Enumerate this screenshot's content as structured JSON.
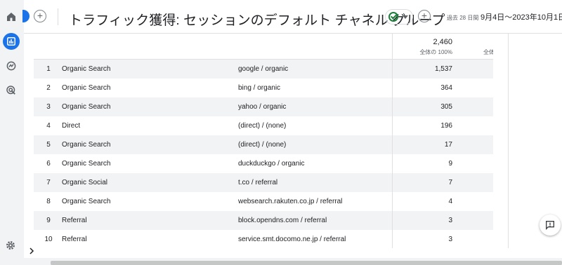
{
  "header": {
    "title": "トラフィック獲得: セッションのデフォルト チャネル グループ",
    "date_label": "過去 28 日間",
    "date_range": "9月4日～2023年10月1日"
  },
  "totals": {
    "value": "2,460",
    "sub": "全体の 100%",
    "sub_next": "全体"
  },
  "rows": [
    {
      "index": "1",
      "group": "Organic Search",
      "source": "google / organic",
      "value": "1,537"
    },
    {
      "index": "2",
      "group": "Organic Search",
      "source": "bing / organic",
      "value": "364"
    },
    {
      "index": "3",
      "group": "Organic Search",
      "source": "yahoo / organic",
      "value": "305"
    },
    {
      "index": "4",
      "group": "Direct",
      "source": "(direct) / (none)",
      "value": "196"
    },
    {
      "index": "5",
      "group": "Organic Search",
      "source": "(direct) / (none)",
      "value": "17"
    },
    {
      "index": "6",
      "group": "Organic Search",
      "source": "duckduckgo / organic",
      "value": "9"
    },
    {
      "index": "7",
      "group": "Organic Social",
      "source": "t.co / referral",
      "value": "7"
    },
    {
      "index": "8",
      "group": "Organic Search",
      "source": "websearch.rakuten.co.jp / referral",
      "value": "4"
    },
    {
      "index": "9",
      "group": "Referral",
      "source": "block.opendns.com / referral",
      "value": "3"
    },
    {
      "index": "10",
      "group": "Referral",
      "source": "service.smt.docomo.ne.jp / referral",
      "value": "3"
    }
  ],
  "icons": {
    "home": "home-icon",
    "reports": "bar-chart-icon",
    "explore": "explore-icon",
    "advertising": "advertising-icon",
    "settings": "gear-icon",
    "expand": "chevron-right-icon",
    "feedback": "feedback-icon",
    "status": "check-circle-icon"
  },
  "colors": {
    "accent": "#1a73e8",
    "status_ok": "#188038"
  }
}
